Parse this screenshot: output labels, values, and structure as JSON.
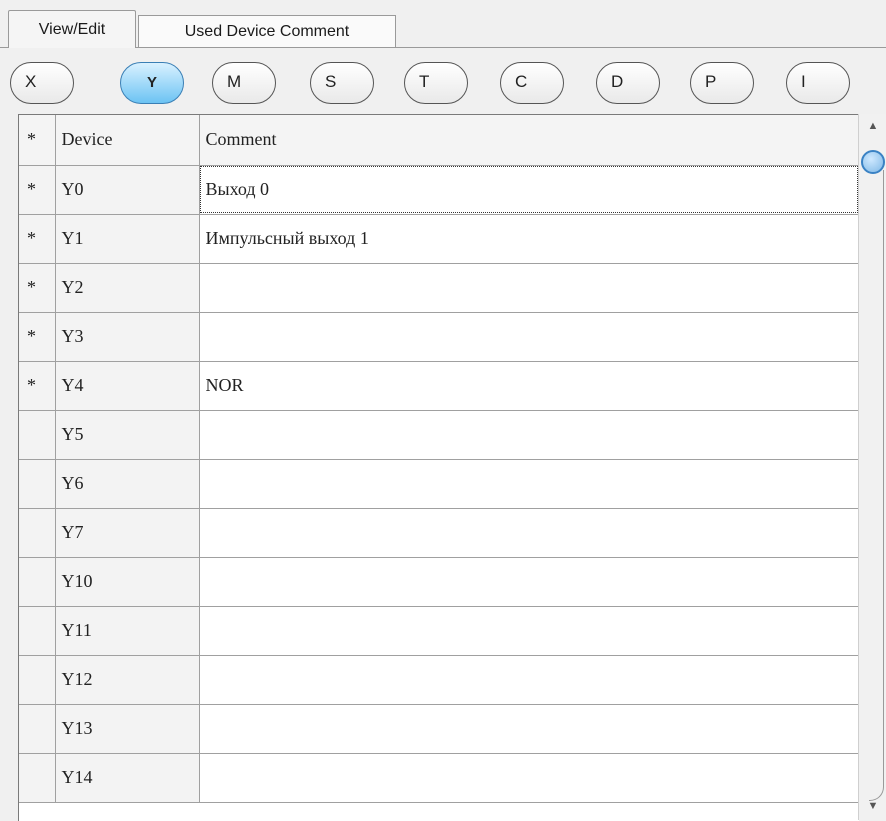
{
  "tabs": [
    {
      "label": "View/Edit",
      "active": true
    },
    {
      "label": "Used Device Comment",
      "active": false
    }
  ],
  "device_types": [
    {
      "label": "X",
      "selected": false
    },
    {
      "label": "Y",
      "selected": true
    },
    {
      "label": "M",
      "selected": false
    },
    {
      "label": "S",
      "selected": false
    },
    {
      "label": "T",
      "selected": false
    },
    {
      "label": "C",
      "selected": false
    },
    {
      "label": "D",
      "selected": false
    },
    {
      "label": "P",
      "selected": false
    },
    {
      "label": "I",
      "selected": false
    }
  ],
  "table": {
    "columns": [
      "*",
      "Device",
      "Comment"
    ],
    "rows": [
      {
        "mark": "*",
        "device": "Y0",
        "comment": "Выход 0"
      },
      {
        "mark": "*",
        "device": "Y1",
        "comment": "Импульсный выход 1"
      },
      {
        "mark": "*",
        "device": "Y2",
        "comment": ""
      },
      {
        "mark": "*",
        "device": "Y3",
        "comment": ""
      },
      {
        "mark": "*",
        "device": "Y4",
        "comment": "NOR"
      },
      {
        "mark": "",
        "device": "Y5",
        "comment": ""
      },
      {
        "mark": "",
        "device": "Y6",
        "comment": ""
      },
      {
        "mark": "",
        "device": "Y7",
        "comment": ""
      },
      {
        "mark": "",
        "device": "Y10",
        "comment": ""
      },
      {
        "mark": "",
        "device": "Y11",
        "comment": ""
      },
      {
        "mark": "",
        "device": "Y12",
        "comment": ""
      },
      {
        "mark": "",
        "device": "Y13",
        "comment": ""
      },
      {
        "mark": "",
        "device": "Y14",
        "comment": ""
      }
    ]
  },
  "scrollbar": {
    "up_icon": "triangle-up",
    "down_icon": "triangle-down",
    "position": 0.0
  },
  "colors": {
    "selected_button": "#6cc3f3",
    "header_bg": "#f4f4f4"
  }
}
